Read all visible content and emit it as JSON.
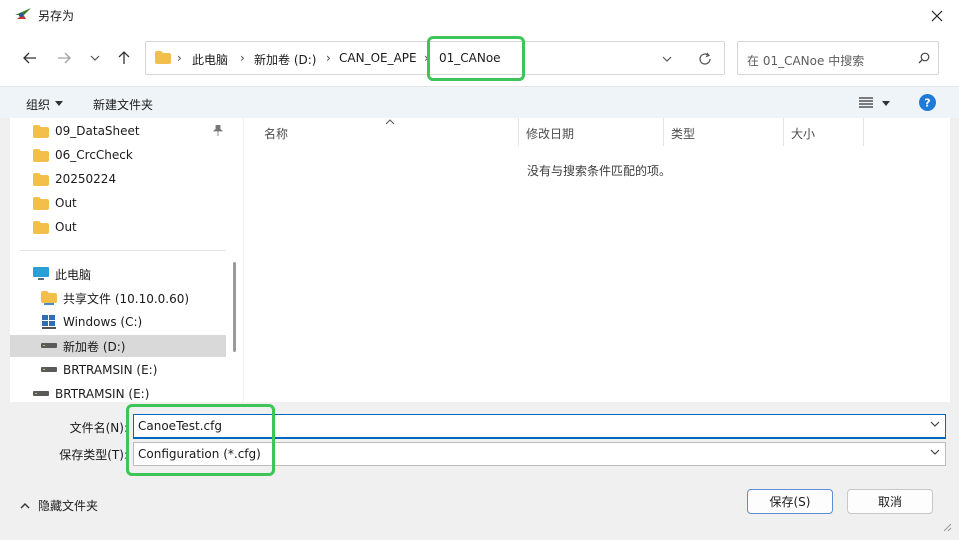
{
  "window": {
    "title": "另存为"
  },
  "address": {
    "crumbs": [
      "此电脑",
      "新加卷 (D:)",
      "CAN_OE_APE",
      "01_CANoe"
    ],
    "separator": "›"
  },
  "search": {
    "placeholder": "在 01_CANoe 中搜索"
  },
  "commandbar": {
    "organize": "组织",
    "new_folder": "新建文件夹"
  },
  "sidebar": {
    "quick": [
      "09_DataSheet",
      "06_CrcCheck",
      "20250224",
      "Out",
      "Out"
    ],
    "this_pc": "此电脑",
    "drives": [
      {
        "label": "共享文件 (10.10.0.60)",
        "icon": "network-folder-icon"
      },
      {
        "label": "Windows  (C:)",
        "icon": "windows-drive-icon"
      },
      {
        "label": "新加卷 (D:)",
        "icon": "drive-icon"
      },
      {
        "label": "BRTRAMSIN (E:)",
        "icon": "drive-icon"
      },
      {
        "label": "BRTRAMSIN (E:)",
        "icon": "drive-icon"
      }
    ]
  },
  "columns": [
    "名称",
    "修改日期",
    "类型",
    "大小"
  ],
  "empty_message": "没有与搜索条件匹配的项。",
  "form": {
    "filename_label": "文件名(N):",
    "filename_value": "CanoeTest.cfg",
    "filetype_label": "保存类型(T):",
    "filetype_value": "Configuration (*.cfg)"
  },
  "footer": {
    "hide_folders": "隐藏文件夹",
    "save": "保存(S)",
    "cancel": "取消"
  },
  "colors": {
    "highlight": "#3fc45a",
    "accent": "#0067c0",
    "folder": "#f2c04a"
  }
}
